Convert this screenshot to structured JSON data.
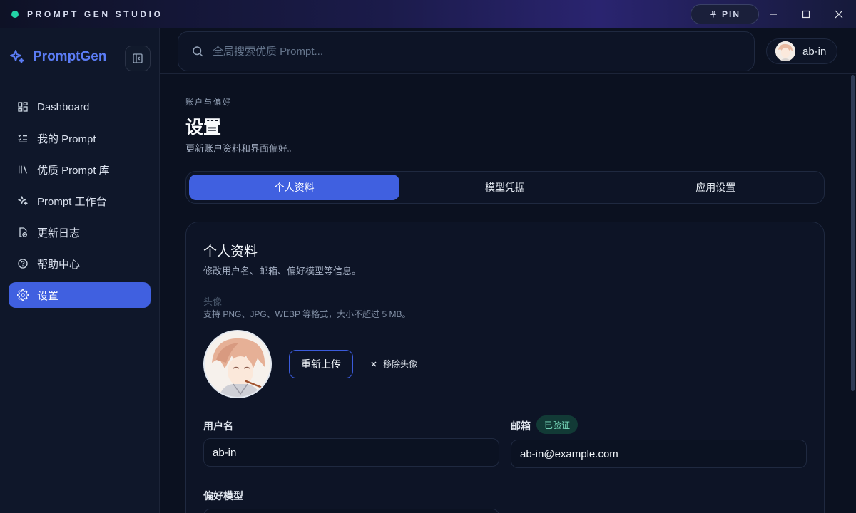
{
  "titlebar": {
    "app_title": "PROMPT GEN STUDIO",
    "pin_label": "PIN"
  },
  "sidebar": {
    "brand": "PromptGen",
    "items": [
      {
        "label": "Dashboard",
        "icon": "grid-icon"
      },
      {
        "label": "我的 Prompt",
        "icon": "list-check-icon"
      },
      {
        "label": "优质 Prompt 库",
        "icon": "library-icon"
      },
      {
        "label": "Prompt 工作台",
        "icon": "sparkles-icon"
      },
      {
        "label": "更新日志",
        "icon": "file-clock-icon"
      },
      {
        "label": "帮助中心",
        "icon": "help-circle-icon"
      },
      {
        "label": "设置",
        "icon": "gear-icon",
        "active": true
      }
    ]
  },
  "topbar": {
    "search_placeholder": "全局搜索优质 Prompt...",
    "username": "ab-in"
  },
  "page": {
    "eyebrow": "账户与偏好",
    "title": "设置",
    "subtitle": "更新账户资料和界面偏好。"
  },
  "tabs": [
    {
      "label": "个人资料",
      "active": true
    },
    {
      "label": "模型凭据",
      "active": false
    },
    {
      "label": "应用设置",
      "active": false
    }
  ],
  "profile": {
    "title": "个人资料",
    "subtitle": "修改用户名、邮箱、偏好模型等信息。",
    "avatar_label": "头像",
    "avatar_hint": "支持 PNG、JPG、WEBP 等格式，大小不超过 5 MB。",
    "reupload_label": "重新上传",
    "remove_label": "移除头像",
    "username_label": "用户名",
    "username_value": "ab-in",
    "email_label": "邮箱",
    "email_verified": "已验证",
    "email_value": "ab-in@example.com",
    "model_label": "偏好模型"
  },
  "colors": {
    "accent": "#4060e0",
    "brand": "#5b7cf5",
    "status": "#22d3a6",
    "verified": "#7ee2c3"
  }
}
